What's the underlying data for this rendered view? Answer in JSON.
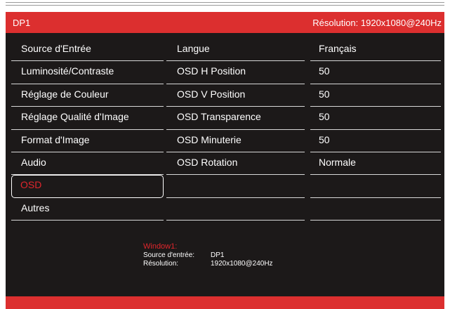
{
  "header": {
    "source": "DP1",
    "resolution": "Résolution: 1920x1080@240Hz"
  },
  "menu": {
    "items": [
      {
        "label": "Source d'Entrée"
      },
      {
        "label": "Luminosité/Contraste"
      },
      {
        "label": "Réglage de Couleur"
      },
      {
        "label": "Réglage Qualité d'Image"
      },
      {
        "label": "Format d'Image"
      },
      {
        "label": "Audio"
      },
      {
        "label": "OSD"
      },
      {
        "label": "Autres"
      }
    ],
    "selected": "OSD"
  },
  "submenu": {
    "items": [
      {
        "label": "Langue",
        "value": "Français"
      },
      {
        "label": "OSD H Position",
        "value": "50"
      },
      {
        "label": "OSD V Position",
        "value": "50"
      },
      {
        "label": "OSD Transparence",
        "value": "50"
      },
      {
        "label": "OSD Minuterie",
        "value": "50"
      },
      {
        "label": "OSD Rotation",
        "value": "Normale"
      }
    ]
  },
  "info": {
    "title": "Window1:",
    "source_label": "Source d'entrée:",
    "source_value": "DP1",
    "resolution_label": "Résolution:",
    "resolution_value": "1920x1080@240Hz"
  },
  "colors": {
    "accent": "#dc2f2f",
    "panel": "#1c1919",
    "selected_text": "#e0262c"
  }
}
